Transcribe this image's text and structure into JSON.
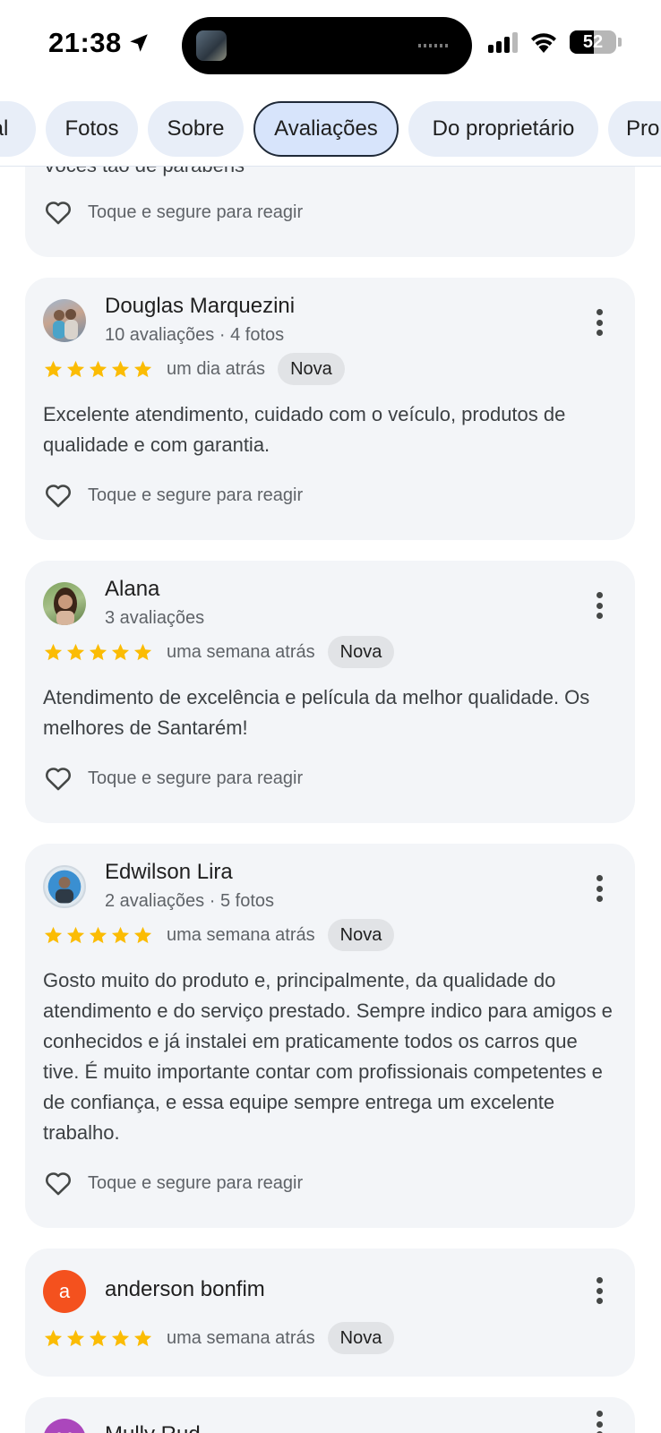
{
  "status_bar": {
    "time": "21:38",
    "battery": "52",
    "battery_level": 0.52,
    "icons": [
      "location-arrow-icon",
      "cellular-signal-icon",
      "wifi-icon",
      "battery-icon"
    ]
  },
  "tabs": [
    {
      "label": "al",
      "active": false
    },
    {
      "label": "Fotos",
      "active": false
    },
    {
      "label": "Sobre",
      "active": false
    },
    {
      "label": "Avaliações",
      "active": true
    },
    {
      "label": "Do proprietário",
      "active": false
    },
    {
      "label": "Pro",
      "active": false
    }
  ],
  "react_label": "Toque e segure para reagir",
  "reviews": [
    {
      "partial_text": "Vocês tão de parabéns",
      "react_label": "Toque e segure para reagir"
    },
    {
      "name": "Douglas Marquezini",
      "meta": "10 avaliações · 4 fotos",
      "rating": 5,
      "time_ago": "um dia atrás",
      "badge": "Nova",
      "text": "Excelente atendimento, cuidado com o veículo, produtos de qualidade e com garantia.",
      "react_label": "Toque e segure para reagir"
    },
    {
      "name": "Alana",
      "meta": "3 avaliações",
      "rating": 5,
      "time_ago": "uma semana atrás",
      "badge": "Nova",
      "text": "Atendimento de excelência e película da melhor qualidade. Os melhores de Santarém!",
      "react_label": "Toque e segure para reagir"
    },
    {
      "name": "Edwilson Lira",
      "meta": "2 avaliações · 5 fotos",
      "rating": 5,
      "time_ago": "uma semana atrás",
      "badge": "Nova",
      "text": "Gosto muito do produto e, principalmente, da qualidade do atendimento e do serviço prestado. Sempre indico para amigos e conhecidos e já instalei em praticamente todos os carros que tive. É muito importante contar com profissionais competentes e de confiança, e essa equipe sempre entrega um excelente trabalho.",
      "react_label": "Toque e segure para reagir"
    },
    {
      "name": "anderson bonfim",
      "avatar_letter": "a",
      "avatar_color": "#f4511e",
      "rating": 5,
      "time_ago": "uma semana atrás",
      "badge": "Nova"
    },
    {
      "name": "Mully Rud",
      "avatar_letter": "M",
      "avatar_color": "#ab47bc"
    }
  ],
  "colors": {
    "star": "#fbbc04",
    "card_bg": "#f3f5f8",
    "active_tab_bg": "#d7e4fb",
    "tab_bg": "#e8eef8"
  }
}
